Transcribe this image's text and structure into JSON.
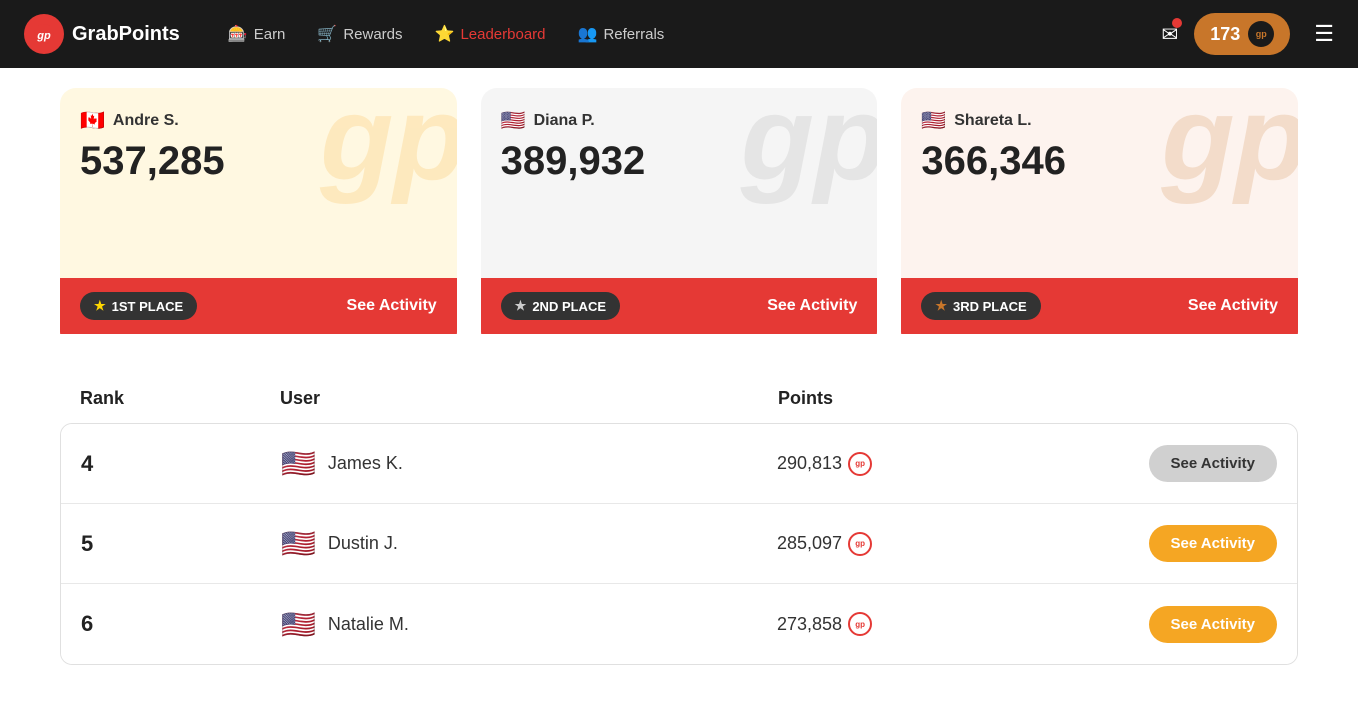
{
  "navbar": {
    "logo_text": "GrabPoints",
    "logo_letter": "gp",
    "nav_items": [
      {
        "id": "earn",
        "label": "Earn",
        "icon": "🎰",
        "active": false
      },
      {
        "id": "rewards",
        "label": "Rewards",
        "icon": "🛒",
        "active": false
      },
      {
        "id": "leaderboard",
        "label": "Leaderboard",
        "icon": "⭐",
        "active": true
      },
      {
        "id": "referrals",
        "label": "Referrals",
        "icon": "👥",
        "active": false
      }
    ],
    "points": "173",
    "gp_label": "gp",
    "hamburger": "☰"
  },
  "top3": [
    {
      "id": "first",
      "rank": "gold",
      "flag": "🇨🇦",
      "name": "Andre S.",
      "points": "537,285",
      "place_label": "1ST PLACE",
      "place_num": 1,
      "star_color": "gold",
      "see_activity": "See Activity",
      "watermark": "gp"
    },
    {
      "id": "second",
      "rank": "silver",
      "flag": "🇺🇸",
      "name": "Diana P.",
      "points": "389,932",
      "place_label": "2ND PLACE",
      "place_num": 2,
      "star_color": "silver",
      "see_activity": "See Activity",
      "watermark": "gp"
    },
    {
      "id": "third",
      "rank": "bronze",
      "flag": "🇺🇸",
      "name": "Shareta L.",
      "points": "366,346",
      "place_label": "3RD PLACE",
      "place_num": 3,
      "star_color": "bronze",
      "see_activity": "See Activity",
      "watermark": "gp"
    }
  ],
  "table": {
    "headers": [
      "Rank",
      "User",
      "Points",
      ""
    ],
    "rows": [
      {
        "rank": "4",
        "flag": "🇺🇸",
        "name": "James K.",
        "points": "290,813",
        "btn_style": "gray",
        "see_activity": "See Activity"
      },
      {
        "rank": "5",
        "flag": "🇺🇸",
        "name": "Dustin J.",
        "points": "285,097",
        "btn_style": "gold",
        "see_activity": "See Activity"
      },
      {
        "rank": "6",
        "flag": "🇺🇸",
        "name": "Natalie M.",
        "points": "273,858",
        "btn_style": "gold",
        "see_activity": "See Activity"
      }
    ]
  }
}
